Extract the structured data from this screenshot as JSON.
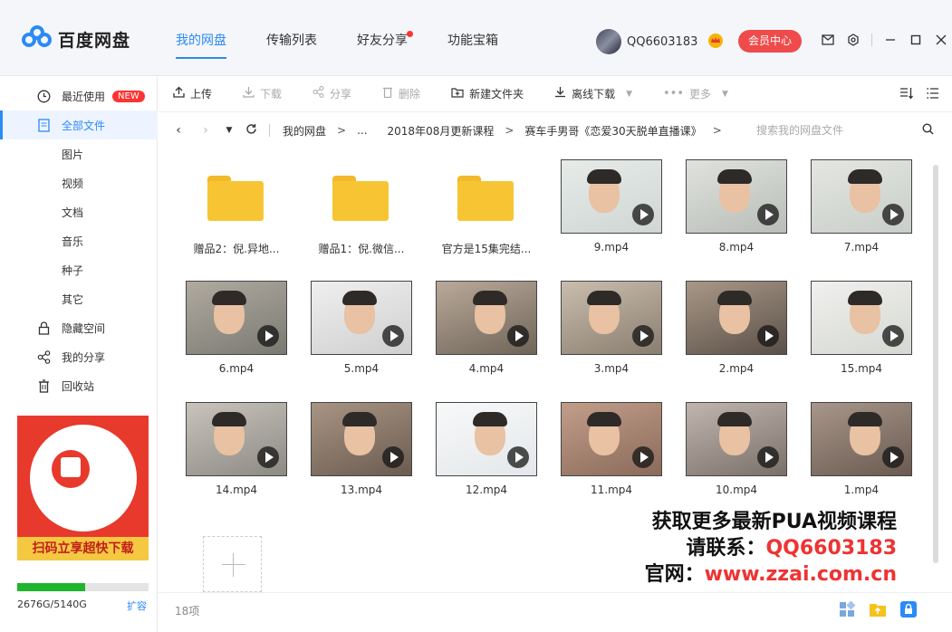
{
  "app": {
    "name": "百度网盘"
  },
  "header": {
    "tabs": [
      {
        "label": "我的网盘"
      },
      {
        "label": "传输列表"
      },
      {
        "label": "好友分享"
      },
      {
        "label": "功能宝箱"
      }
    ],
    "username": "QQ6603183",
    "vip_label": "会员中心"
  },
  "sidebar": {
    "items": [
      {
        "label": "最近使用",
        "badge": "NEW"
      },
      {
        "label": "全部文件"
      },
      {
        "label": "图片"
      },
      {
        "label": "视频"
      },
      {
        "label": "文档"
      },
      {
        "label": "音乐"
      },
      {
        "label": "种子"
      },
      {
        "label": "其它"
      },
      {
        "label": "隐藏空间"
      },
      {
        "label": "我的分享"
      },
      {
        "label": "回收站"
      }
    ],
    "promo_text": "扫码立享超快下载",
    "storage_text": "2676G/5140G",
    "storage_used_fraction": 0.52,
    "expand_label": "扩容"
  },
  "toolbar": {
    "upload": "上传",
    "download": "下载",
    "share": "分享",
    "delete": "删除",
    "new_folder": "新建文件夹",
    "offline": "离线下载",
    "more": "更多"
  },
  "breadcrumb": {
    "items": [
      "我的网盘",
      "...",
      "2018年08月更新课程",
      "赛车手男哥《恋爱30天脱单直播课》"
    ],
    "separator": ">"
  },
  "search": {
    "placeholder": "搜索我的网盘文件"
  },
  "files": [
    {
      "name": "赠品2：倪.异地...",
      "type": "folder"
    },
    {
      "name": "赠品1：倪.微信...",
      "type": "folder"
    },
    {
      "name": "官方是15集完结...",
      "type": "folder"
    },
    {
      "name": "9.mp4",
      "type": "video"
    },
    {
      "name": "8.mp4",
      "type": "video"
    },
    {
      "name": "7.mp4",
      "type": "video"
    },
    {
      "name": "6.mp4",
      "type": "video"
    },
    {
      "name": "5.mp4",
      "type": "video"
    },
    {
      "name": "4.mp4",
      "type": "video"
    },
    {
      "name": "3.mp4",
      "type": "video"
    },
    {
      "name": "2.mp4",
      "type": "video"
    },
    {
      "name": "15.mp4",
      "type": "video"
    },
    {
      "name": "14.mp4",
      "type": "video"
    },
    {
      "name": "13.mp4",
      "type": "video"
    },
    {
      "name": "12.mp4",
      "type": "video"
    },
    {
      "name": "11.mp4",
      "type": "video"
    },
    {
      "name": "10.mp4",
      "type": "video"
    },
    {
      "name": "1.mp4",
      "type": "video"
    }
  ],
  "watermark": {
    "line1": "获取更多最新PUA视频课程",
    "line2_prefix": "请联系：",
    "line2_value": "QQ6603183",
    "line3_prefix": "官网：",
    "line3_value": "www.zzai.com.cn"
  },
  "footer": {
    "count": "18项"
  },
  "colors": {
    "accent": "#2b8af6",
    "vip": "#ef4b4b",
    "watermark_red": "#e33333"
  }
}
